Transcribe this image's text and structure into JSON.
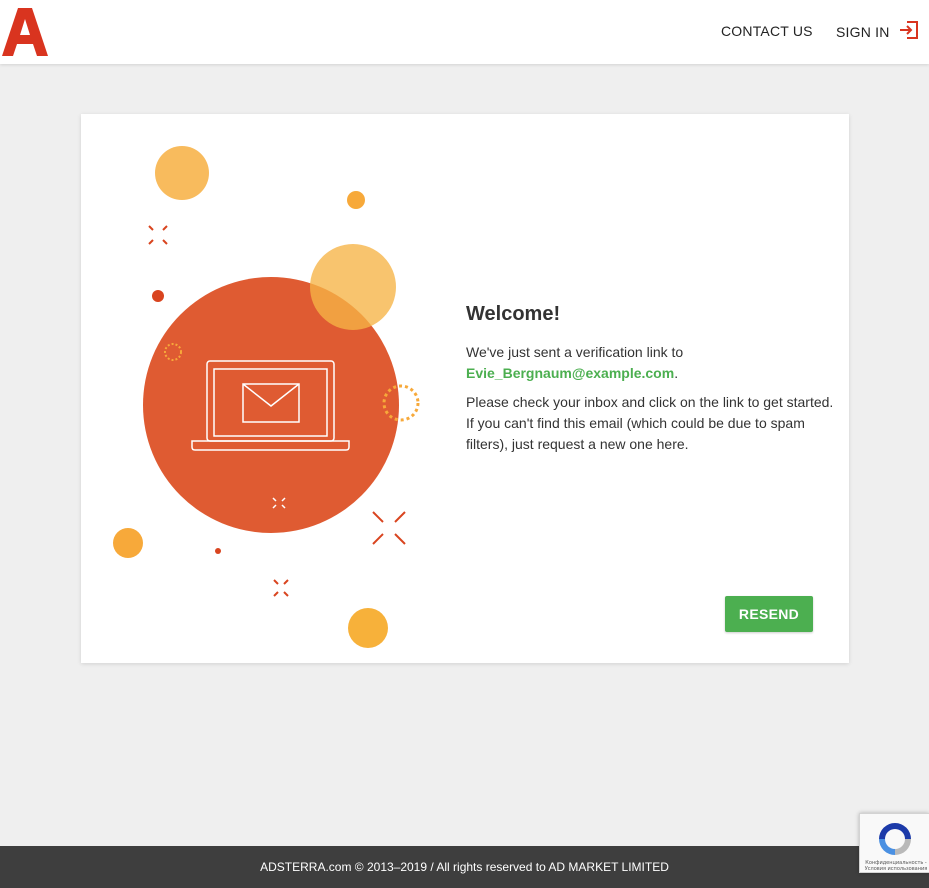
{
  "header": {
    "logo_letter": "A",
    "contact_label": "CONTACT US",
    "signin_label": "SIGN IN"
  },
  "main": {
    "title": "Welcome!",
    "message_1_prefix": "We've just sent a verification link to",
    "email": "Evie_Bergnaum@example.com",
    "message_1_suffix": ".",
    "message_2": "Please check your inbox and click on the link to get started. If you can't find this email (which could be due to spam filters), just request a new one here.",
    "resend_label": "RESEND"
  },
  "footer": {
    "text": "ADSTERRA.com © 2013–2019 / All rights reserved to AD MARKET LIMITED"
  },
  "recaptcha": {
    "text": "Конфиденциальность - Условия использования"
  },
  "colors": {
    "brand_red": "#d9341f",
    "accent_green": "#4caf50",
    "illustration_orange": "#df5b32",
    "illustration_yellow": "#f7a93a"
  },
  "icons": [
    "adsterra-logo",
    "sign-in-icon",
    "laptop-mail-icon",
    "recaptcha-icon"
  ]
}
